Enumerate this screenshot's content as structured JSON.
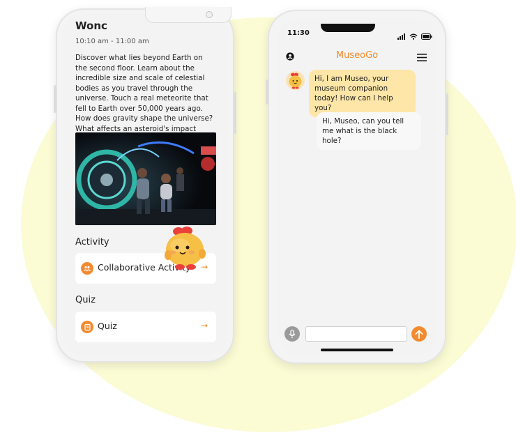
{
  "left_phone": {
    "event": {
      "title": "Wonc",
      "time": "10:10 am - 11:00 am",
      "description": "Discover what lies beyond Earth on the second floor. Learn about the incredible size and scale of celestial bodies as you travel through the universe. Touch a real meteorite that fell to Earth over 50,000 years ago. How does gravity shape the universe? What affects an asteroid's impact crater?"
    },
    "activity": {
      "heading": "Activity",
      "card_label": "Collaborative Activity",
      "arrow": "→"
    },
    "quiz": {
      "heading": "Quiz",
      "card_label": "Quiz",
      "arrow": "→"
    }
  },
  "right_phone": {
    "status_time": "11:30",
    "app_title": "MuseoGo",
    "messages": [
      {
        "sender": "bot",
        "text": "Hi, I am Museo, your museum companion today! How can I help you?"
      },
      {
        "sender": "user",
        "text": "Hi, Museo, can you tell me what is the black hole?"
      }
    ],
    "composer": {
      "placeholder": "",
      "value": ""
    }
  },
  "colors": {
    "accent": "#f08a2d",
    "background_blob": "#fbfbd4",
    "bot_bubble": "#fde6a7",
    "user_bubble": "#f8f8f8"
  },
  "icons": [
    "account-icon",
    "menu-icon",
    "mic-icon",
    "send-arrow-icon",
    "group-icon",
    "quiz-icon",
    "wifi-icon",
    "battery-icon",
    "signal-icon"
  ]
}
